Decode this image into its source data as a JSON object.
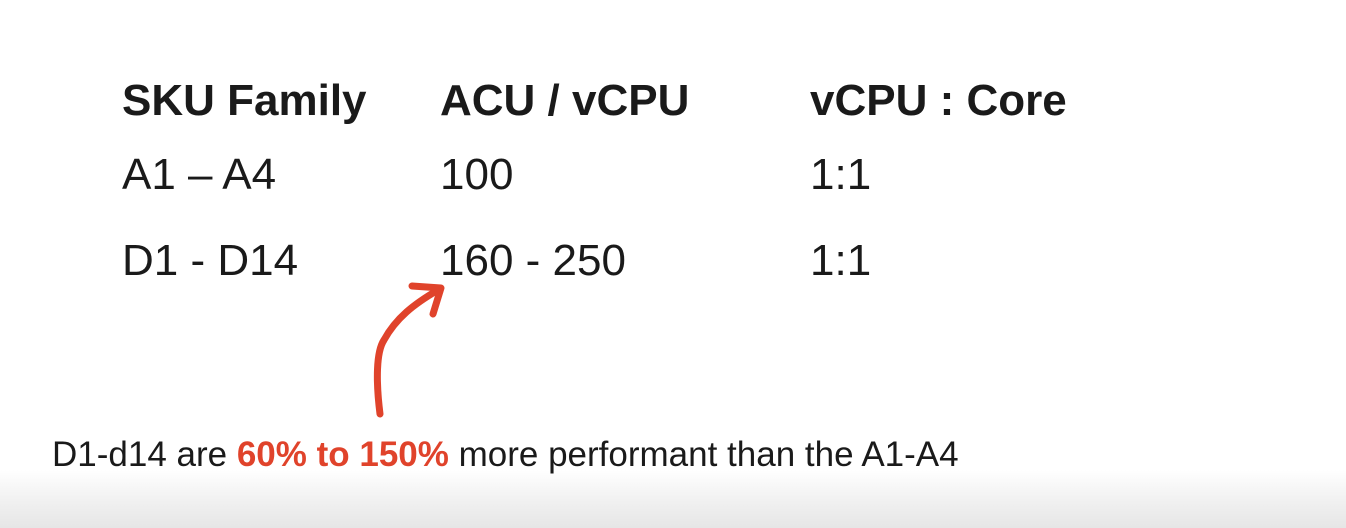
{
  "table": {
    "headers": [
      "SKU Family",
      "ACU / vCPU",
      "vCPU : Core"
    ],
    "rows": [
      [
        "A1 – A4",
        "100",
        "1:1"
      ],
      [
        "D1 - D14",
        "160 - 250",
        "1:1"
      ]
    ]
  },
  "caption": {
    "before": "D1-d14 are ",
    "highlight": "60% to 150%",
    "after": " more performant than the A1-A4"
  },
  "colors": {
    "highlight": "#e0432b",
    "arrow": "#e0432b",
    "text": "#1a1a1a"
  }
}
